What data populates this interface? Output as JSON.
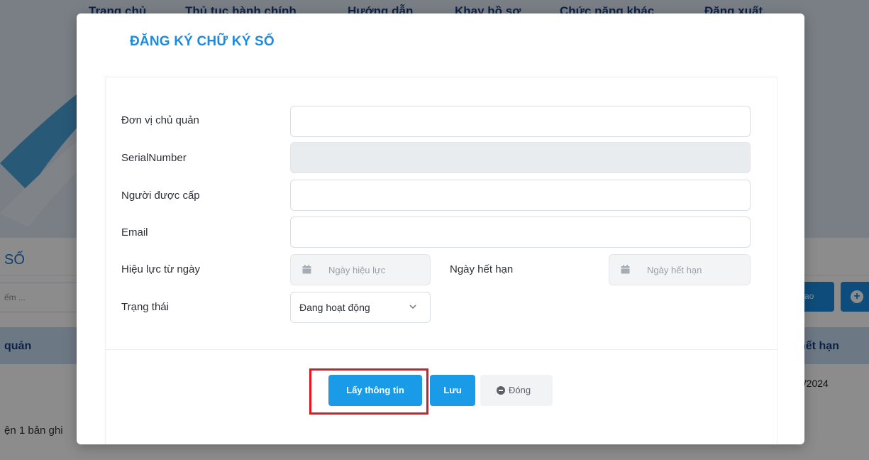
{
  "background": {
    "nav": [
      "Trang chủ",
      "Thủ tục hành chính",
      "Hướng dẫn",
      "Khay hồ sơ",
      "Chức năng khác",
      "Đăng xuất"
    ],
    "section_title": "SỐ",
    "search_placeholder": "ếm ...",
    "advanced_button": "ao",
    "table_headers": [
      "quản",
      "hết hạn"
    ],
    "cell_date": "1/2024",
    "record_count": "ện 1 bản ghi"
  },
  "modal": {
    "title": "ĐĂNG KÝ CHỮ KÝ SỐ",
    "fields": {
      "unit_label": "Đơn vị chủ quản",
      "unit_value": "",
      "serial_label": "SerialNumber",
      "serial_value": "",
      "holder_label": "Người được cấp",
      "holder_value": "",
      "email_label": "Email",
      "email_value": "",
      "valid_from_label": "Hiệu lực từ ngày",
      "valid_from_placeholder": "Ngày hiệu lực",
      "expiry_label": "Ngày hết hạn",
      "expiry_placeholder": "Ngày hết hạn",
      "status_label": "Trạng thái",
      "status_value": "Đang hoạt động"
    },
    "buttons": {
      "get_info": "Lấy thông tin",
      "save": "Lưu",
      "close": "Đóng"
    }
  },
  "colors": {
    "accent": "#1a9be8",
    "title": "#1a8ce0",
    "highlight": "#e8141c"
  },
  "icons": [
    "calendar-icon",
    "chevron-down-icon",
    "minus-circle-icon",
    "plus-circle-icon"
  ]
}
